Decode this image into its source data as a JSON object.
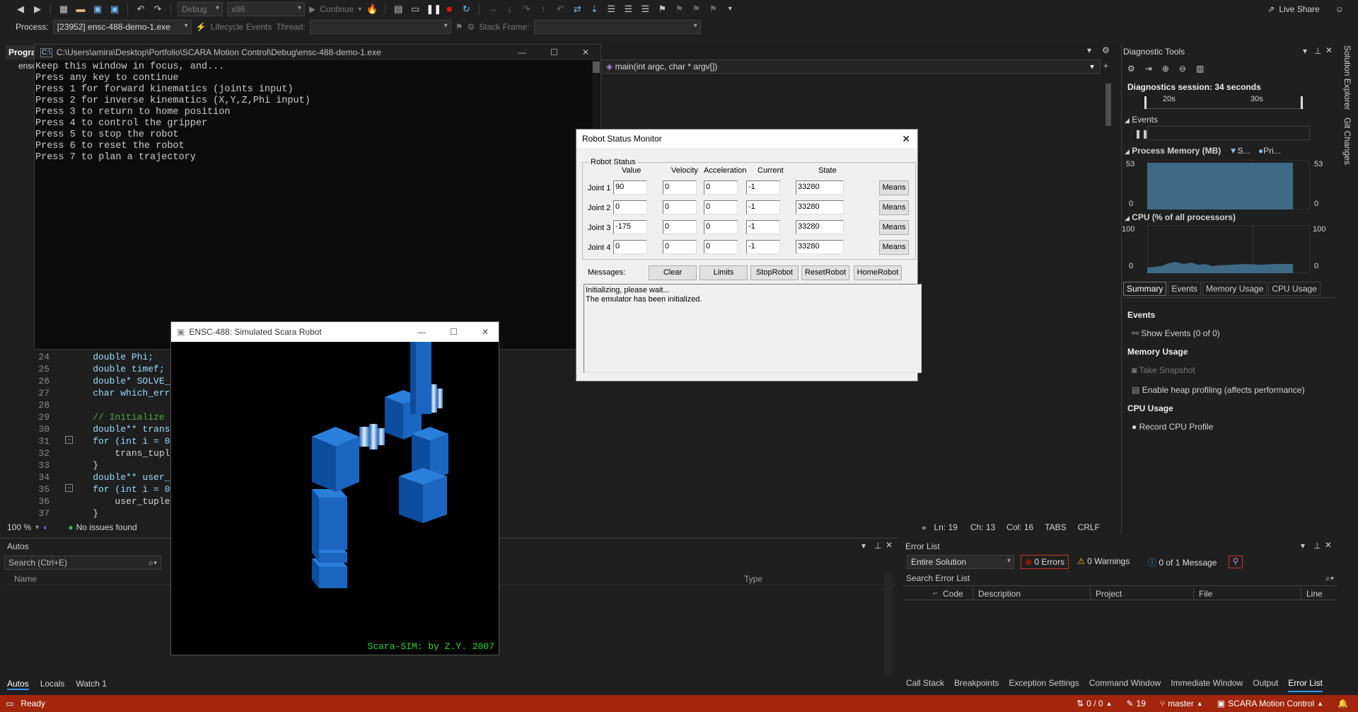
{
  "toolbar": {
    "config": "Debug",
    "platform": "x86",
    "continue_label": "Continue",
    "live_share": "Live Share"
  },
  "toolbar2": {
    "process_label": "Process:",
    "process_value": "[23952] ensc-488-demo-1.exe",
    "lifecycle_label": "Lifecycle Events",
    "thread_label": "Thread:",
    "stack_frame_label": "Stack Frame:"
  },
  "editor": {
    "tab_label": "Progra",
    "tab2_label": "ensc",
    "nav_function": "main(int argc, char * argv[])",
    "lines": [
      {
        "n": "24",
        "code": "    double Phi;"
      },
      {
        "n": "25",
        "code": "    double timef;"
      },
      {
        "n": "26",
        "code": "    double* SOLVE_"
      },
      {
        "n": "27",
        "code": "    char which_err"
      },
      {
        "n": "28",
        "code": ""
      },
      {
        "n": "29",
        "code": "    // Initialize"
      },
      {
        "n": "30",
        "code": "    double** trans"
      },
      {
        "n": "31",
        "code": "    for (int i = 0"
      },
      {
        "n": "32",
        "code": "        trans_tuple"
      },
      {
        "n": "33",
        "code": "    }"
      },
      {
        "n": "34",
        "code": "    double** user_"
      },
      {
        "n": "35",
        "code": "    for (int i = 0"
      },
      {
        "n": "36",
        "code": "        user_tuple"
      },
      {
        "n": "37",
        "code": "    }"
      }
    ],
    "zoom": "100 %",
    "issues": "No issues found",
    "ln": "Ln: 19",
    "ch": "Ch: 13",
    "col": "Col: 16",
    "tabs": "TABS",
    "crlf": "CRLF"
  },
  "console": {
    "title": "C:\\Users\\amira\\Desktop\\Portfolio\\SCARA Motion Control\\Debug\\ensc-488-demo-1.exe",
    "text": "Keep this window in focus, and...\nPress any key to continue\nPress 1 for forward kinematics (joints input)\nPress 2 for inverse kinematics (X,Y,Z,Phi input)\nPress 3 to return to home position\nPress 4 to control the gripper\nPress 5 to stop the robot\nPress 6 to reset the robot\nPress 7 to plan a trajectory"
  },
  "rsm": {
    "title": "Robot Status Monitor",
    "group_label": "Robot Status",
    "headers": [
      "Value",
      "Velocity",
      "Acceleration",
      "Current",
      "State"
    ],
    "joints": [
      {
        "label": "Joint 1",
        "value": "90",
        "velocity": "0",
        "acceleration": "0",
        "current": "-1",
        "state": "33280",
        "btn": "Means"
      },
      {
        "label": "Joint 2",
        "value": "0",
        "velocity": "0",
        "acceleration": "0",
        "current": "-1",
        "state": "33280",
        "btn": "Means"
      },
      {
        "label": "Joint 3",
        "value": "-175",
        "velocity": "0",
        "acceleration": "0",
        "current": "-1",
        "state": "33280",
        "btn": "Means"
      },
      {
        "label": "Joint 4",
        "value": "0",
        "velocity": "0",
        "acceleration": "0",
        "current": "-1",
        "state": "33280",
        "btn": "Means"
      }
    ],
    "messages_label": "Messages:",
    "buttons": [
      "Clear",
      "Limits",
      "StopRobot",
      "ResetRobot",
      "HomeRobot"
    ],
    "messages": "Initializing, please wait...\nThe emulator has been initialized."
  },
  "scara": {
    "title": "ENSC-488: Simulated Scara Robot",
    "credit": "Scara-SIM: by Z.Y. 2007"
  },
  "diag": {
    "title": "Diagnostic Tools",
    "session": "Diagnostics session: 34 seconds",
    "tick_20": "20s",
    "tick_30": "30s",
    "events_label": "Events",
    "memory_label": "Process Memory (MB)",
    "mem_legend1": "S...",
    "mem_legend2": "Pri...",
    "mem_max": "53",
    "mem_min": "0",
    "cpu_label": "CPU (% of all processors)",
    "cpu_max": "100",
    "cpu_min": "0",
    "tabs": [
      "Summary",
      "Events",
      "Memory Usage",
      "CPU Usage"
    ],
    "sec_events": "Events",
    "show_events": "Show Events (0 of 0)",
    "sec_memory": "Memory Usage",
    "take_snapshot": "Take Snapshot",
    "heap_profiling": "Enable heap profiling (affects performance)",
    "sec_cpu": "CPU Usage",
    "record_cpu": "Record CPU Profile"
  },
  "side": {
    "solution_explorer": "Solution Explorer",
    "git_changes": "Git Changes"
  },
  "autos": {
    "title": "Autos",
    "search_placeholder": "Search (Ctrl+E)",
    "col_name": "Name",
    "col_type": "Type",
    "tabs": [
      "Autos",
      "Locals",
      "Watch 1"
    ]
  },
  "errlist": {
    "title": "Error List",
    "scope": "Entire Solution",
    "errors": "0 Errors",
    "warnings": "0 Warnings",
    "messages": "0 of 1 Message",
    "search_placeholder": "Search Error List",
    "cols": [
      "Code",
      "Description",
      "Project",
      "File",
      "Line"
    ],
    "bottom_tabs": [
      "Call Stack",
      "Breakpoints",
      "Exception Settings",
      "Command Window",
      "Immediate Window",
      "Output",
      "Error List"
    ]
  },
  "statusbar": {
    "ready": "Ready",
    "updown": "0 / 0",
    "pencil": "19",
    "branch": "master",
    "repo": "SCARA Motion Control"
  },
  "colors": {
    "status_bg": "#a1260d",
    "chart_fill": "#3f6a85",
    "robot_blue": "#1b6fd1"
  }
}
